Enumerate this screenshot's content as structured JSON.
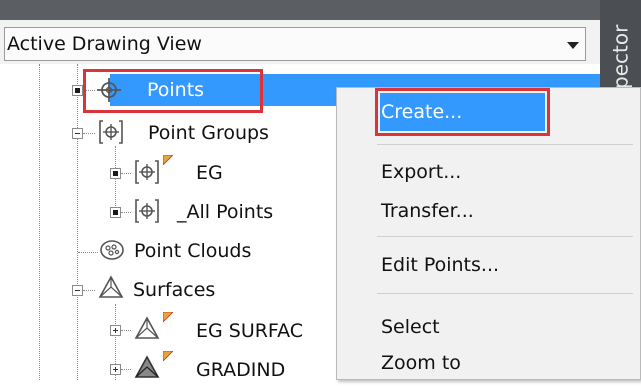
{
  "window": {
    "side_tab_label": "spector"
  },
  "view_selector": {
    "value": "Active Drawing View"
  },
  "tree": {
    "points": "Points",
    "point_groups": "Point Groups",
    "eg": "EG",
    "all_points": "_All Points",
    "point_clouds": "Point Clouds",
    "surfaces": "Surfaces",
    "eg_surface": "EG SURFAC",
    "gradind": "GRADIND"
  },
  "context_menu": {
    "create": "Create...",
    "export": "Export...",
    "transfer": "Transfer...",
    "edit_points": "Edit Points...",
    "select": "Select",
    "zoom_to": "Zoom to"
  },
  "colors": {
    "selection": "#3399ff",
    "highlight_box": "#d9343a",
    "window_chrome": "#5b5e63"
  },
  "icons": {
    "points": "crosshair-icon",
    "point_group": "bracketed-crosshair-icon",
    "point_clouds": "cloud-icon",
    "surfaces": "triangle-surface-icon"
  }
}
